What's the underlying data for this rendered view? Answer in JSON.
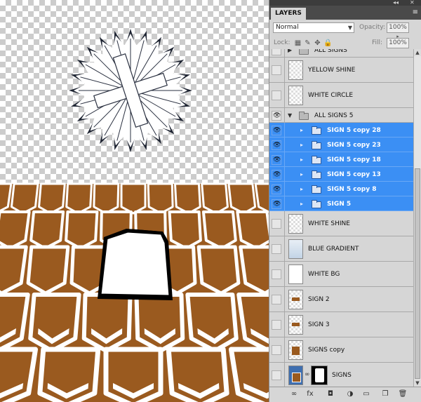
{
  "panel": {
    "tab_label": "LAYERS",
    "collapse_glyph": "◂◂",
    "close_glyph": "✕",
    "menu_glyph": "≡",
    "blend_mode": "Normal",
    "opacity_label": "Opacity:",
    "opacity_value": "100%",
    "lock_label": "Lock:",
    "fill_label": "Fill:",
    "fill_value": "100%"
  },
  "layers": [
    {
      "name": "ALL SIGNS",
      "kind": "group",
      "visible": false,
      "expanded": false,
      "selected": false,
      "indent": 0
    },
    {
      "name": "YELLOW SHINE",
      "kind": "layer",
      "visible": false,
      "thumb": "checker",
      "selected": false
    },
    {
      "name": "WHITE CIRCLE",
      "kind": "layer",
      "visible": false,
      "thumb": "checker",
      "selected": false
    },
    {
      "name": "ALL SIGNS 5",
      "kind": "group",
      "visible": true,
      "expanded": true,
      "selected": false,
      "indent": 0
    },
    {
      "name": "SIGN 5 copy 28",
      "kind": "group",
      "visible": true,
      "expanded": false,
      "selected": true,
      "indent": 1
    },
    {
      "name": "SIGN 5 copy 23",
      "kind": "group",
      "visible": true,
      "expanded": false,
      "selected": true,
      "indent": 1
    },
    {
      "name": "SIGN 5 copy 18",
      "kind": "group",
      "visible": true,
      "expanded": false,
      "selected": true,
      "indent": 1
    },
    {
      "name": "SIGN 5 copy 13",
      "kind": "group",
      "visible": true,
      "expanded": false,
      "selected": true,
      "indent": 1
    },
    {
      "name": "SIGN 5 copy 8",
      "kind": "group",
      "visible": true,
      "expanded": false,
      "selected": true,
      "indent": 1
    },
    {
      "name": "SIGN 5",
      "kind": "group",
      "visible": true,
      "expanded": false,
      "selected": true,
      "indent": 1
    },
    {
      "name": "WHITE SHINE",
      "kind": "layer",
      "visible": false,
      "thumb": "checker",
      "selected": false
    },
    {
      "name": "BLUE GRADIENT",
      "kind": "layer",
      "visible": false,
      "thumb": "blue",
      "selected": false
    },
    {
      "name": "WHITE BG",
      "kind": "layer",
      "visible": false,
      "thumb": "white",
      "selected": false
    },
    {
      "name": "SIGN 2",
      "kind": "layer",
      "visible": false,
      "thumb": "sign",
      "selected": false
    },
    {
      "name": "SIGN 3",
      "kind": "layer",
      "visible": false,
      "thumb": "sign",
      "selected": false
    },
    {
      "name": "SIGNS copy",
      "kind": "layer",
      "visible": false,
      "thumb": "signs",
      "selected": false
    },
    {
      "name": "SIGNS",
      "kind": "layer",
      "visible": false,
      "thumb": "masked",
      "selected": false
    }
  ],
  "footer_icons": [
    "link-icon",
    "fx-icon",
    "mask-icon",
    "adjustment-icon",
    "new-group-icon",
    "new-layer-icon",
    "trash-icon"
  ],
  "footer_glyphs": [
    "∞",
    "fx",
    "◘",
    "◑",
    "▭",
    "❐",
    "🗑"
  ],
  "colors": {
    "selection": "#3b8ff4",
    "panel_bg": "#d6d6d6",
    "sign_brown": "#9a5a1f",
    "sign_white": "#ffffff"
  }
}
